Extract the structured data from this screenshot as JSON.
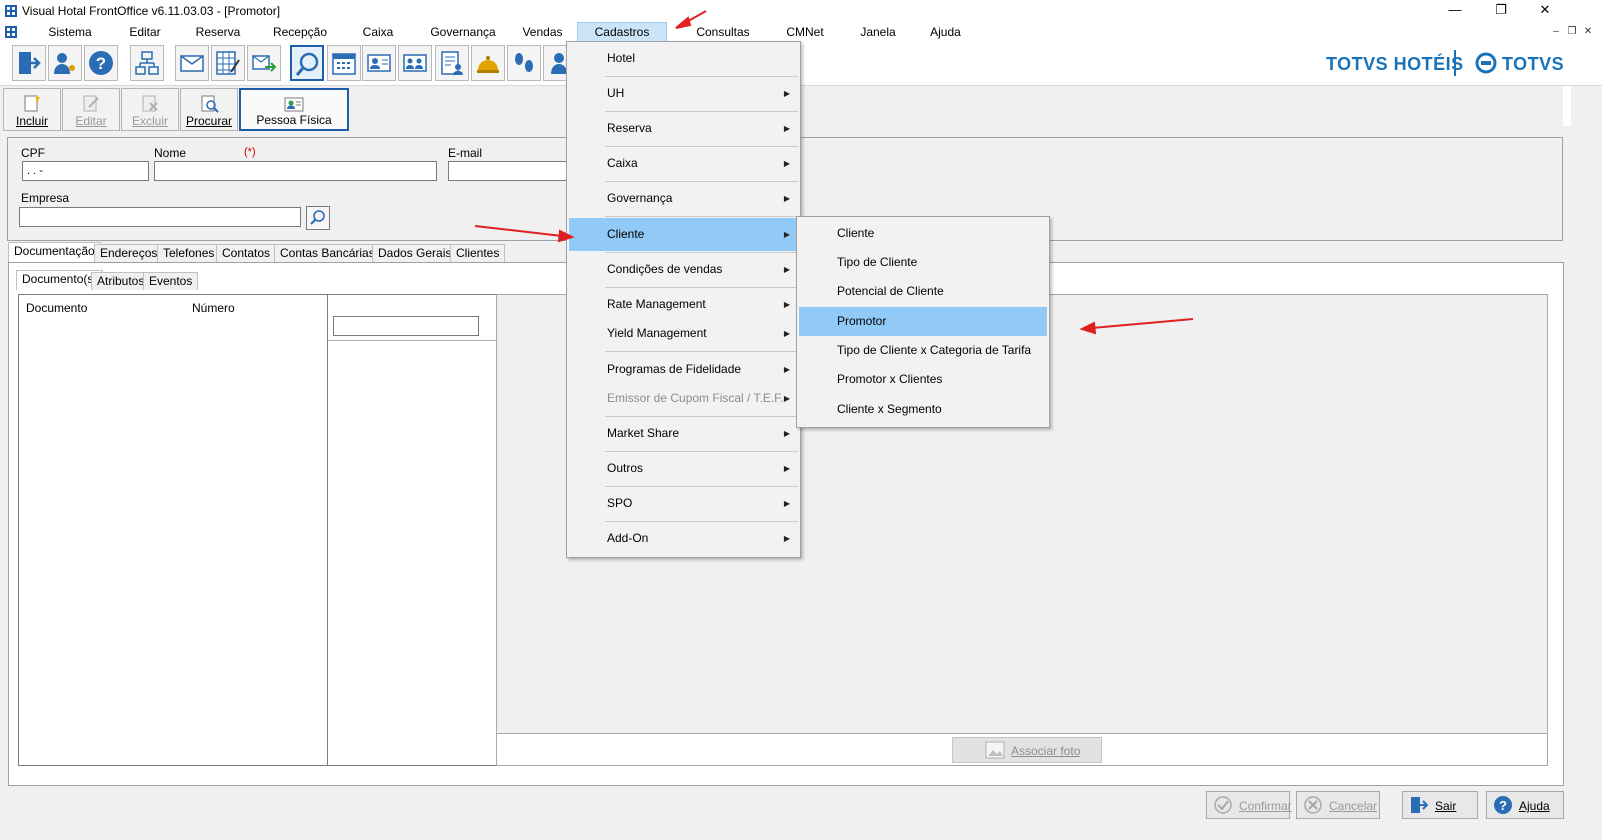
{
  "window": {
    "title": "Visual Hotal FrontOffice v6.11.03.03 - [Promotor]",
    "controls": {
      "minimize": "—",
      "restore": "❐",
      "close": "✕"
    }
  },
  "menubar": {
    "items": [
      "Sistema",
      "Editar",
      "Reserva",
      "Recepção",
      "Caixa",
      "Governança",
      "Vendas",
      "Cadastros",
      "Consultas",
      "CMNet",
      "Janela",
      "Ajuda"
    ],
    "active": "Cadastros",
    "mdi_controls": [
      "–",
      "❐",
      "✕"
    ]
  },
  "brand": {
    "left": "TOTVS HOTÉIS",
    "right": "TOTVS"
  },
  "secondary_toolbar": {
    "buttons": [
      {
        "label": "Incluir",
        "enabled": true
      },
      {
        "label": "Editar",
        "enabled": false
      },
      {
        "label": "Excluir",
        "enabled": false
      },
      {
        "label": "Procurar",
        "enabled": true
      },
      {
        "label": "Pessoa Física",
        "enabled": true
      }
    ]
  },
  "form": {
    "cpf_label": "CPF",
    "cpf_value": ".  .  -",
    "nome_label": "Nome",
    "required_mark": "(*)",
    "email_label": "E-mail",
    "empresa_label": "Empresa"
  },
  "tabs": [
    "Documentação",
    "Endereços",
    "Telefones",
    "Contatos",
    "Contas Bancárias",
    "Dados Gerais",
    "Clientes"
  ],
  "subtabs": [
    "Documento(s)",
    "Atributos",
    "Eventos"
  ],
  "doc_table": {
    "columns": [
      "Documento",
      "Número"
    ]
  },
  "photo": {
    "associate_label": "Associar foto"
  },
  "bottom_buttons": [
    {
      "label": "Confirmar",
      "enabled": false
    },
    {
      "label": "Cancelar",
      "enabled": false
    },
    {
      "label": "Sair",
      "enabled": true
    },
    {
      "label": "Ajuda",
      "enabled": true
    }
  ],
  "cadastros_menu": {
    "items": [
      {
        "label": "Hotel",
        "submenu": false
      },
      {
        "label": "UH",
        "submenu": true
      },
      {
        "label": "Reserva",
        "submenu": true
      },
      {
        "label": "Caixa",
        "submenu": true
      },
      {
        "label": "Governança",
        "submenu": true
      },
      {
        "label": "Cliente",
        "submenu": true,
        "highlighted": true
      },
      {
        "label": "Condições de vendas",
        "submenu": true
      },
      {
        "label": "Rate Management",
        "submenu": true
      },
      {
        "label": "Yield Management",
        "submenu": true
      },
      {
        "label": "Programas de Fidelidade",
        "submenu": true
      },
      {
        "label": "Emissor de Cupom Fiscal / T.E.F.",
        "submenu": true,
        "disabled": true
      },
      {
        "label": "Market Share",
        "submenu": true
      },
      {
        "label": "Outros",
        "submenu": true
      },
      {
        "label": "SPO",
        "submenu": true
      },
      {
        "label": "Add-On",
        "submenu": true
      }
    ]
  },
  "cliente_submenu": {
    "items": [
      "Cliente",
      "Tipo de Cliente",
      "Potencial de Cliente",
      "Promotor",
      "Tipo de Cliente x Categoria de Tarifa",
      "Promotor x Clientes",
      "Cliente x Segmento"
    ],
    "highlighted": "Promotor"
  },
  "colors": {
    "highlight": "#91c9f7",
    "brand": "#1a73b8",
    "annotation_arrow": "#e02020",
    "required": "#d00000"
  }
}
